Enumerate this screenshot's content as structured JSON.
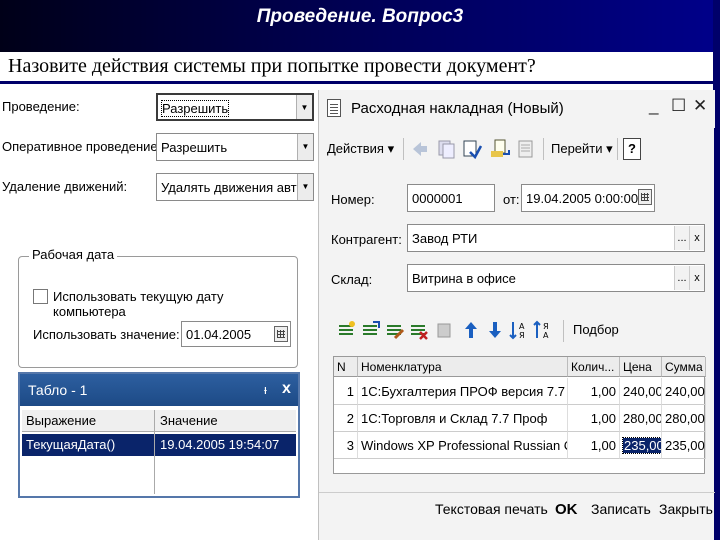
{
  "slide": {
    "title": "Проведение. Вопрос3",
    "question": "Назовите действия системы при попытке провести документ?"
  },
  "settings": [
    {
      "label": "Проведение:",
      "value": "Разрешить"
    },
    {
      "label": "Оперативное проведение:",
      "value": "Разрешить"
    },
    {
      "label": "Удаление движений:",
      "value": "Удалять движения авто"
    }
  ],
  "workdate": {
    "title": "Рабочая дата",
    "checkbox_label": "Использовать текущую дату компьютера",
    "value_label": "Использовать значение:",
    "value": "01.04.2005"
  },
  "tablo": {
    "title": "Табло - 1",
    "pin": "ᵻ",
    "close": "x",
    "columns": [
      "Выражение",
      "Значение"
    ],
    "row": {
      "expr": "ТекущаяДата()",
      "value": "19.04.2005 19:54:07"
    }
  },
  "doc": {
    "title": "Расходная накладная (Новый)",
    "window_buttons": {
      "minimize": "_",
      "maximize": "☐",
      "close": "✕"
    },
    "toolbar": {
      "actions": "Действия ▾",
      "goto": "Перейти ▾",
      "help": "?"
    },
    "number_label": "Номер:",
    "number": "0000001",
    "from_label": "от:",
    "date": "19.04.2005 0:00:00",
    "contractor_label": "Контрагент:",
    "contractor": "Завод РТИ",
    "warehouse_label": "Склад:",
    "warehouse": "Витрина в офисе",
    "select_label": "Подбор",
    "ellipsis": "...",
    "x": "x",
    "grid": {
      "headers": [
        "N",
        "Номенклатура",
        "Колич...",
        "Цена",
        "Сумма"
      ],
      "rows": [
        {
          "n": "1",
          "name": "1С:Бухгалтерия ПРОФ версия 7.7",
          "qty": "1,00",
          "price": "240,00",
          "sum": "240,00"
        },
        {
          "n": "2",
          "name": "1С:Торговля и Склад 7.7 Проф",
          "qty": "1,00",
          "price": "280,00",
          "sum": "280,00"
        },
        {
          "n": "3",
          "name": "Windows XP Professional Russian CD",
          "qty": "1,00",
          "price": "235,00",
          "sum": "235,00"
        }
      ]
    },
    "buttons": {
      "print": "Текстовая печать",
      "ok": "OK",
      "save": "Записать",
      "close": "Закрыть"
    }
  },
  "colors": {
    "header_bg": "#00004a",
    "selection": "#0a246a",
    "tablo_header": "#2d5fa0"
  }
}
